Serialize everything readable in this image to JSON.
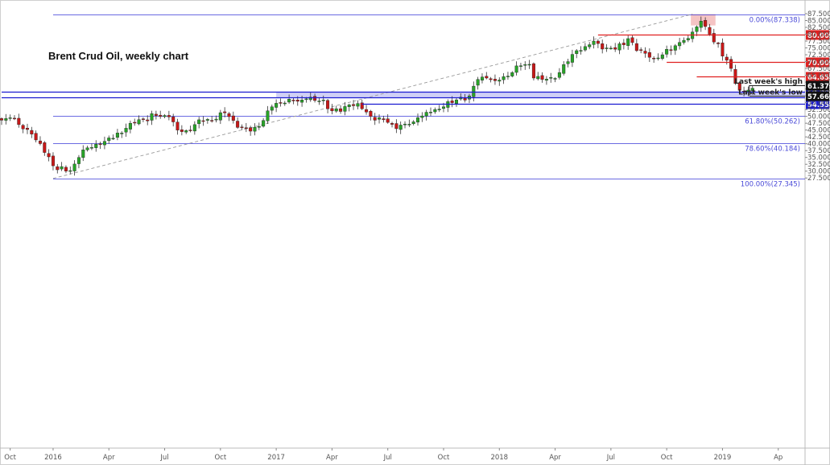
{
  "chart_data": {
    "type": "candlestick",
    "title": "Brent Crud Oil, weekly chart",
    "ylim": [
      26.2,
      88.2
    ],
    "y_ticks": [
      "27.500",
      "30.000",
      "32.500",
      "35.000",
      "37.500",
      "40.000",
      "42.500",
      "45.000",
      "47.500",
      "50.000",
      "52.500",
      "55.000",
      "57.500",
      "60.000",
      "62.500",
      "65.000",
      "67.500",
      "70.000",
      "72.500",
      "75.000",
      "77.500",
      "80.000",
      "82.500",
      "85.000",
      "87.500"
    ],
    "x_ticks": [
      {
        "label": "Oct",
        "week": 2
      },
      {
        "label": "2016",
        "week": 12
      },
      {
        "label": "Apr",
        "week": 25
      },
      {
        "label": "Jul",
        "week": 38
      },
      {
        "label": "Oct",
        "week": 51
      },
      {
        "label": "2017",
        "week": 64
      },
      {
        "label": "Apr",
        "week": 77
      },
      {
        "label": "Jul",
        "week": 90
      },
      {
        "label": "Oct",
        "week": 103
      },
      {
        "label": "2018",
        "week": 116
      },
      {
        "label": "Apr",
        "week": 129
      },
      {
        "label": "Jul",
        "week": 142
      },
      {
        "label": "Oct",
        "week": 155
      },
      {
        "label": "2019",
        "week": 168
      },
      {
        "label": "Ap",
        "week": 181
      }
    ],
    "key_points": [
      [
        0,
        48.6
      ],
      [
        2,
        49.5
      ],
      [
        4,
        47.0
      ],
      [
        7,
        43.5
      ],
      [
        10,
        36.8
      ],
      [
        13,
        30.5
      ],
      [
        16,
        30.2
      ],
      [
        18,
        35.0
      ],
      [
        20,
        38.5
      ],
      [
        23,
        39.8
      ],
      [
        26,
        42.0
      ],
      [
        30,
        47.5
      ],
      [
        33,
        49.0
      ],
      [
        36,
        50.3
      ],
      [
        39,
        49.8
      ],
      [
        41,
        45.0
      ],
      [
        43,
        44.8
      ],
      [
        45,
        47.0
      ],
      [
        47,
        48.2
      ],
      [
        50,
        49.0
      ],
      [
        52,
        51.3
      ],
      [
        54,
        48.5
      ],
      [
        56,
        46.0
      ],
      [
        58,
        44.6
      ],
      [
        60,
        46.3
      ],
      [
        61,
        48.5
      ],
      [
        63,
        53.5
      ],
      [
        65,
        55.0
      ],
      [
        67,
        56.3
      ],
      [
        69,
        55.5
      ],
      [
        71,
        56.4
      ],
      [
        73,
        55.8
      ],
      [
        75,
        56.0
      ],
      [
        77,
        52.0
      ],
      [
        79,
        51.8
      ],
      [
        81,
        54.2
      ],
      [
        83,
        54.7
      ],
      [
        85,
        51.6
      ],
      [
        86,
        50.0
      ],
      [
        88,
        49.5
      ],
      [
        90,
        47.8
      ],
      [
        92,
        45.5
      ],
      [
        94,
        47.2
      ],
      [
        96,
        48.0
      ],
      [
        97,
        49.5
      ],
      [
        99,
        51.5
      ],
      [
        101,
        52.5
      ],
      [
        103,
        53.5
      ],
      [
        105,
        55.0
      ],
      [
        107,
        57.0
      ],
      [
        109,
        57.5
      ],
      [
        111,
        63.5
      ],
      [
        113,
        64.0
      ],
      [
        115,
        63.0
      ],
      [
        117,
        64.5
      ],
      [
        119,
        66.0
      ],
      [
        121,
        68.5
      ],
      [
        123,
        69.0
      ],
      [
        124,
        64.0
      ],
      [
        126,
        63.5
      ],
      [
        128,
        64.2
      ],
      [
        130,
        66.0
      ],
      [
        132,
        70.0
      ],
      [
        134,
        74.0
      ],
      [
        136,
        75.5
      ],
      [
        138,
        77.5
      ],
      [
        139,
        76.6
      ],
      [
        141,
        75.0
      ],
      [
        143,
        74.5
      ],
      [
        144,
        76.5
      ],
      [
        146,
        78.4
      ],
      [
        148,
        74.0
      ],
      [
        150,
        73.0
      ],
      [
        152,
        71.0
      ],
      [
        154,
        72.5
      ],
      [
        155,
        74.5
      ],
      [
        157,
        75.8
      ],
      [
        158,
        77.0
      ],
      [
        160,
        78.5
      ],
      [
        161,
        80.8
      ],
      [
        162,
        82.7
      ],
      [
        163,
        84.8
      ],
      [
        164,
        82.8
      ],
      [
        165,
        80.0
      ],
      [
        167,
        76.5
      ],
      [
        168,
        72.0
      ],
      [
        169,
        70.5
      ],
      [
        170,
        67.5
      ],
      [
        171,
        62.0
      ],
      [
        172,
        59.5
      ],
      [
        173,
        58.8
      ],
      [
        174,
        59.6
      ],
      [
        175,
        60.3
      ]
    ],
    "horizontal_levels": [
      {
        "price": 80.0,
        "label": "80.000",
        "color": "#e02020",
        "from_week": 139
      },
      {
        "price": 70.0,
        "label": "70.000",
        "color": "#e02020",
        "from_week": 155
      },
      {
        "price": 64.65,
        "label": "64.650",
        "color": "#e02020",
        "from_week": 162
      },
      {
        "price": 59.0,
        "label": "59.000",
        "color": "#1a1ad0",
        "from_week": 0
      },
      {
        "price": 57.0,
        "label": "57.000",
        "color": "#1a1ad0",
        "from_week": 0
      },
      {
        "price": 54.55,
        "label": "54.550",
        "color": "#1a1ad0",
        "from_week": 84
      }
    ],
    "fibonacci": [
      {
        "label": "0.00%(87.338)",
        "price": 87.338
      },
      {
        "label": "61.80%(50.262)",
        "price": 50.262
      },
      {
        "label": "78.60%(40.184)",
        "price": 40.184
      },
      {
        "label": "100.00%(27.345)",
        "price": 27.345
      }
    ],
    "fib_line_color": "#3a3ad8",
    "support_zone": {
      "from_week": 64,
      "low": 57.0,
      "high": 59.0,
      "color": "#c8c8f4"
    },
    "peak_highlight": {
      "week_start": 161,
      "week_end": 166,
      "low": 83.2,
      "high": 87.338,
      "color": "#f5c4c4"
    },
    "price_tags": [
      {
        "label": "61.370",
        "price": 61.37,
        "bg": "#111111"
      },
      {
        "label": "57.660",
        "price": 57.66,
        "bg": "#111111"
      }
    ],
    "annotations": [
      {
        "text": "Last week's high",
        "price": 61.37
      },
      {
        "text": "Last week's low",
        "price": 57.66
      }
    ],
    "up_color": "#28a428",
    "down_color": "#c81818",
    "trendline": {
      "from": [
        12,
        27.345
      ],
      "to": [
        161,
        87.338
      ],
      "style": "dashed",
      "color": "#999999"
    }
  }
}
